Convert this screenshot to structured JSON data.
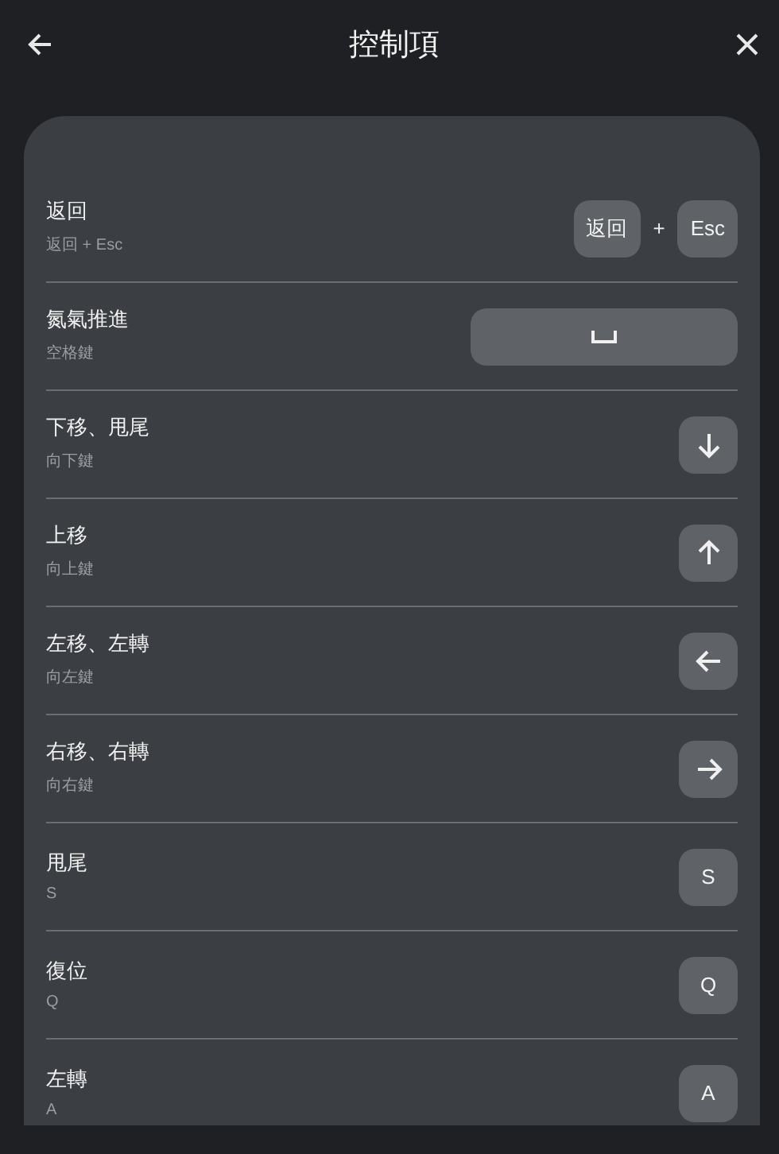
{
  "header": {
    "title": "控制項"
  },
  "controls": [
    {
      "name": "返回",
      "binding": "返回 + Esc",
      "keys": [
        {
          "kind": "text",
          "label": "返回"
        },
        {
          "kind": "plus",
          "label": "+"
        },
        {
          "kind": "text",
          "label": "Esc"
        }
      ]
    },
    {
      "name": "氮氣推進",
      "binding": "空格鍵",
      "keys": [
        {
          "kind": "space"
        }
      ]
    },
    {
      "name": "下移、甩尾",
      "binding": "向下鍵",
      "keys": [
        {
          "kind": "down"
        }
      ]
    },
    {
      "name": "上移",
      "binding": "向上鍵",
      "keys": [
        {
          "kind": "up"
        }
      ]
    },
    {
      "name": "左移、左轉",
      "binding": "向左鍵",
      "keys": [
        {
          "kind": "left"
        }
      ]
    },
    {
      "name": "右移、右轉",
      "binding": "向右鍵",
      "keys": [
        {
          "kind": "right"
        }
      ]
    },
    {
      "name": "甩尾",
      "binding": "S",
      "keys": [
        {
          "kind": "text",
          "label": "S"
        }
      ]
    },
    {
      "name": "復位",
      "binding": "Q",
      "keys": [
        {
          "kind": "text",
          "label": "Q"
        }
      ]
    },
    {
      "name": "左轉",
      "binding": "A",
      "keys": [
        {
          "kind": "text",
          "label": "A"
        }
      ]
    }
  ]
}
